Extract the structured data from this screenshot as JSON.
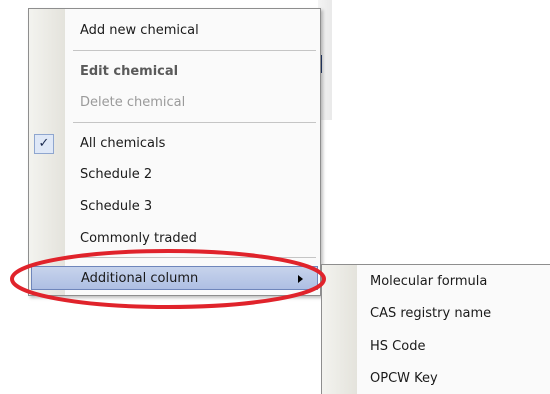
{
  "context_menu": {
    "items": [
      {
        "label": "Add new chemical",
        "state": "normal"
      },
      {
        "label": "Edit chemical",
        "state": "bold"
      },
      {
        "label": "Delete chemical",
        "state": "disabled"
      },
      {
        "label": "All chemicals",
        "state": "checked",
        "check_glyph": "✓"
      },
      {
        "label": "Schedule 2",
        "state": "normal"
      },
      {
        "label": "Schedule 3",
        "state": "normal"
      },
      {
        "label": "Commonly traded",
        "state": "normal"
      },
      {
        "label": "Additional column",
        "state": "highlighted",
        "has_submenu": true
      }
    ]
  },
  "submenu": {
    "items": [
      {
        "label": "Molecular formula"
      },
      {
        "label": "CAS registry name"
      },
      {
        "label": "HS Code"
      },
      {
        "label": "OPCW Key"
      }
    ]
  },
  "colors": {
    "highlight": "#aebfe3",
    "annotation": "#e0232b",
    "check_background": "#dfe8f7"
  }
}
